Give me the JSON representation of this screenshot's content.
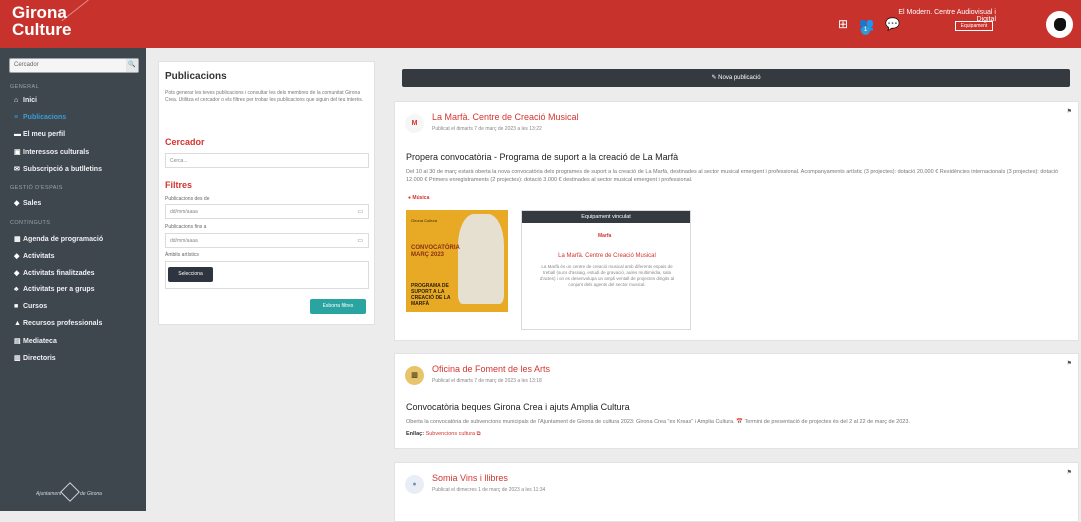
{
  "header": {
    "logo_line1": "Girona",
    "logo_line2": "Culture",
    "notifications_badge": "1",
    "user_name": "El Modern. Centre Audiovisual i Digital",
    "user_role": "Equipament",
    "icons": [
      "login-icon",
      "users-icon",
      "chat-icon"
    ]
  },
  "sidebar": {
    "search_placeholder": "Cercador",
    "section_general": "GENERAL",
    "section_gestio": "GESTIÓ D'ESPAIS",
    "section_continguts": "CONTINGUTS",
    "items": [
      {
        "label": "Inici",
        "icon": "home-icon",
        "active": false
      },
      {
        "label": "Publicacions",
        "icon": "list-icon",
        "active": true
      },
      {
        "label": "El meu perfil",
        "icon": "profile-icon",
        "active": false
      },
      {
        "label": "Interessos culturals",
        "icon": "interests-icon",
        "active": false
      },
      {
        "label": "Subscripció a butlletins",
        "icon": "mail-icon",
        "active": false
      },
      {
        "label": "Sales",
        "icon": "tag-icon",
        "active": false
      },
      {
        "label": "Agenda de programació",
        "icon": "calendar-icon",
        "active": false
      },
      {
        "label": "Activitats",
        "icon": "tag-icon",
        "active": false
      },
      {
        "label": "Activitats finalitzades",
        "icon": "tag-icon",
        "active": false
      },
      {
        "label": "Activitats per a grups",
        "icon": "group-icon",
        "active": false
      },
      {
        "label": "Cursos",
        "icon": "course-icon",
        "active": false
      },
      {
        "label": "Recursos professionals",
        "icon": "warning-icon",
        "active": false
      },
      {
        "label": "Mediateca",
        "icon": "media-icon",
        "active": false
      },
      {
        "label": "Directoris",
        "icon": "directory-icon",
        "active": false
      }
    ],
    "footer_text_left": "Ajuntament",
    "footer_text_right": "de Girona"
  },
  "filters": {
    "title": "Publicacions",
    "description": "Pots generar les teves publicacions i consultar les dels membres de la comunitat Girona Crea. Utilitza el cercador o els filtres per trobar les publicacions que siguin del teu interès.",
    "search_heading": "Cercador",
    "search_placeholder": "Cerca...",
    "filters_heading": "Filtres",
    "date_from_label": "Publicacions des de",
    "date_from_placeholder": "dd/mm/aaaa",
    "date_to_label": "Publicacions fins a",
    "date_to_placeholder": "dd/mm/aaaa",
    "area_label": "Àmbits artístics",
    "select_button": "Selecciona",
    "clear_button": "Esborra filtres"
  },
  "feed": {
    "new_post_button": "Nova publicació",
    "posts": [
      {
        "org": "La Marfà. Centre de Creació Musical",
        "date": "Publicat el dimarts 7 de març de 2023 a les 13:22",
        "title": "Propera convocatòria - Programa de suport a la creació de La Marfà",
        "text": "Del 10 al 30 de març estarà oberta la nova convocatòria dels programes de suport a la creació de La Marfà, destinades al sector musical emergent i professional.  Acompanyaments artístic (3 projectes): dotació 20.000 € Residències internacionals (3 projectes): dotació 12.000 € Primers enregistraments (2 projectes): dotació 3.000 € destinades al sector musical emergent i professional.",
        "tag": "Música",
        "poster_small": "Girona Cultura",
        "poster_title": "CONVOCATÒRIA MARÇ 2023",
        "poster_subtitle": "PROGRAMA DE SUPORT A LA CREACIÓ DE LA MARFÀ",
        "equip_header": "Equipament vinculat",
        "equip_name": "La Marfà. Centre de Creació Musical",
        "equip_desc": "La Marfà és un centre de creació musical amb diferents espais de treball (sucs d'assaig, estudi de gravació, aules multimèdia, sala d'actes) i on es desenvolupa un ampli ventall de projectes dirigits al conjunt dels agents del sector musical."
      },
      {
        "org": "Oficina de Foment de les Arts",
        "date": "Publicat el dimarts 7 de març de 2023 a les 13:18",
        "title": "Convocatòria beques Girona Crea i ajuts Amplia Cultura",
        "text": "Oberta la convocatòria de subvencions municipals de l'Ajuntament de Girona de cultura 2023: Girona Crea \"ex Kreas\" i Amplia Cultura. 📅 Termini de presentació de projectes és del 2 al 22 de març de 2023.",
        "link_label": "Enllaç:",
        "link_text": "Subvencions cultura"
      },
      {
        "org": "Somia Vins i llibres",
        "date": "Publicat el dimecres 1 de març de 2023 a les 11:34"
      }
    ]
  }
}
